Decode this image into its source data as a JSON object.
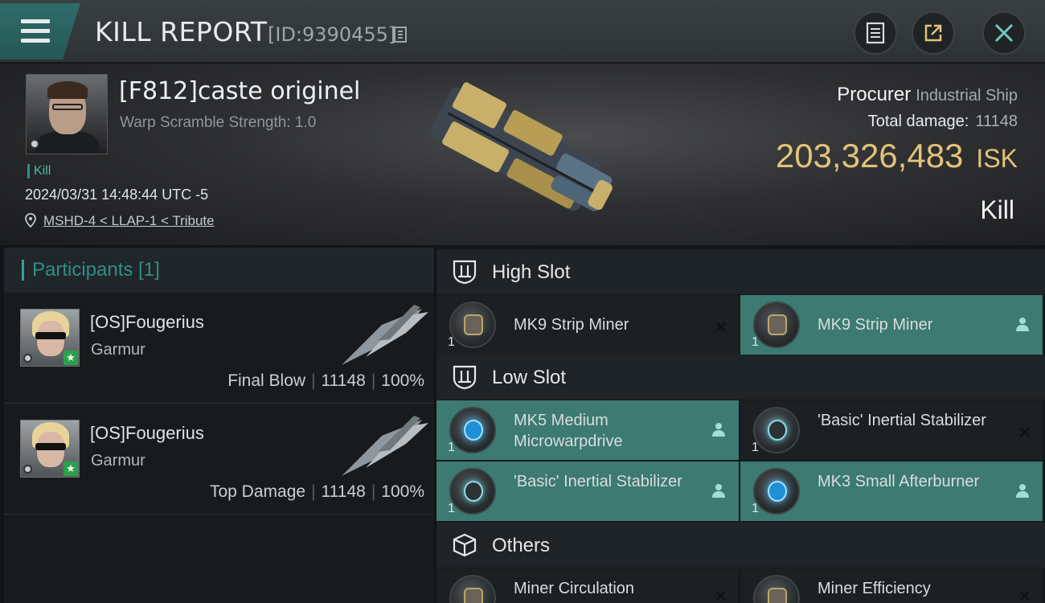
{
  "header": {
    "title": "KILL REPORT",
    "report_id": "[ID:9390455]"
  },
  "victim": {
    "name": "[F812]caste originel",
    "scramble": "Warp Scramble Strength: 1.0",
    "tag": "Kill",
    "datetime": "2024/03/31 14:48:44 UTC -5",
    "location": "MSHD-4 < LLAP-1 < Tribute"
  },
  "ship": {
    "name": "Procurer",
    "class": "Industrial Ship",
    "total_damage_label": "Total damage:",
    "total_damage": "11148",
    "isk_value": "203,326,483",
    "isk_unit": "ISK",
    "result": "Kill"
  },
  "participants": {
    "title": "Participants [1]",
    "rows": [
      {
        "name": "[OS]Fougerius",
        "ship": "Garmur",
        "role": "Final Blow",
        "damage": "11148",
        "percent": "100%"
      },
      {
        "name": "[OS]Fougerius",
        "ship": "Garmur",
        "role": "Top Damage",
        "damage": "11148",
        "percent": "100%"
      }
    ]
  },
  "fitting": {
    "high_slot": {
      "label": "High Slot",
      "modules": [
        {
          "name": "MK9 Strip Miner",
          "qty": "1",
          "status": "destroyed"
        },
        {
          "name": "MK9 Strip Miner",
          "qty": "1",
          "status": "dropped"
        }
      ]
    },
    "low_slot": {
      "label": "Low Slot",
      "modules": [
        {
          "name": "MK5 Medium Microwarpdrive",
          "qty": "1",
          "status": "dropped"
        },
        {
          "name": "'Basic' Inertial Stabilizer",
          "qty": "1",
          "status": "destroyed"
        },
        {
          "name": "'Basic' Inertial Stabilizer",
          "qty": "1",
          "status": "dropped"
        },
        {
          "name": "MK3 Small Afterburner",
          "qty": "1",
          "status": "dropped"
        }
      ]
    },
    "others": {
      "label": "Others",
      "modules": [
        {
          "name": "Miner Circulation",
          "status": "destroyed"
        },
        {
          "name": "Miner Efficiency",
          "status": "destroyed"
        }
      ]
    }
  },
  "colors": {
    "accent_teal": "#3c7a72",
    "isk_gold": "#e3c37a"
  }
}
